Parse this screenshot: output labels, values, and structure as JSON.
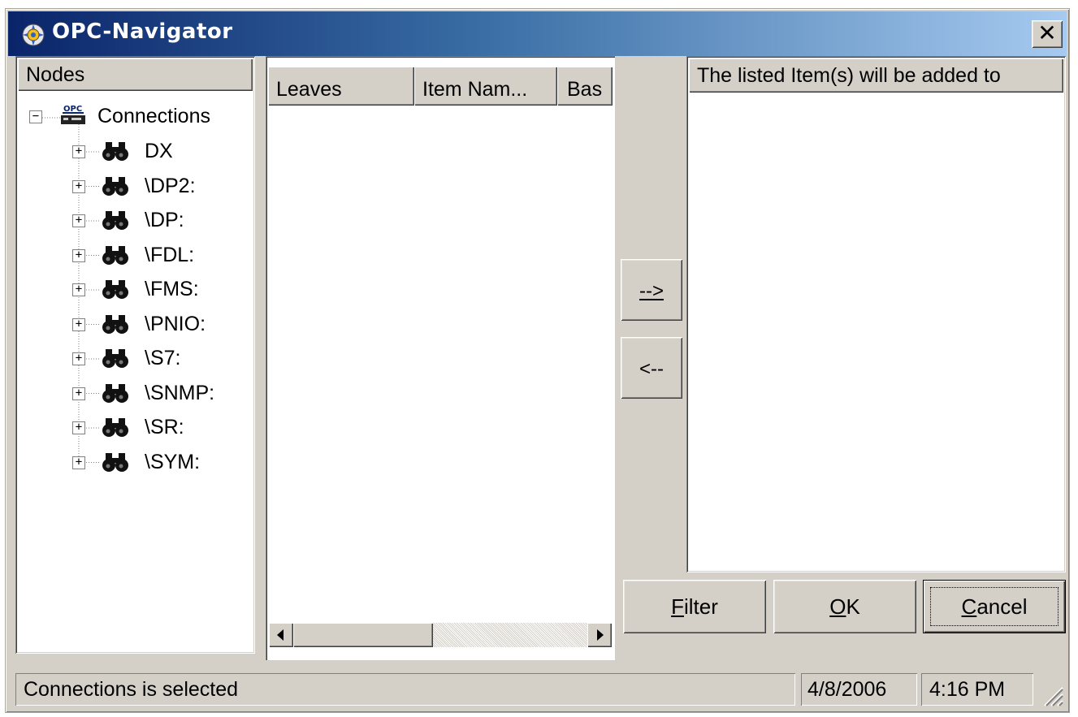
{
  "window": {
    "title": "OPC-Navigator",
    "close_glyph": "✕"
  },
  "nodes_panel": {
    "header": "Nodes",
    "root": {
      "label": "Connections",
      "icon": "opc-server-icon",
      "expander": "⊟"
    },
    "children": [
      {
        "label": "DX",
        "icon": "binoculars-icon"
      },
      {
        "label": "\\DP2:",
        "icon": "binoculars-icon"
      },
      {
        "label": "\\DP:",
        "icon": "binoculars-icon"
      },
      {
        "label": "\\FDL:",
        "icon": "binoculars-icon"
      },
      {
        "label": "\\FMS:",
        "icon": "binoculars-icon"
      },
      {
        "label": "\\PNIO:",
        "icon": "binoculars-icon"
      },
      {
        "label": "\\S7:",
        "icon": "binoculars-icon"
      },
      {
        "label": "\\SNMP:",
        "icon": "binoculars-icon"
      },
      {
        "label": "\\SR:",
        "icon": "binoculars-icon"
      },
      {
        "label": "\\SYM:",
        "icon": "binoculars-icon"
      }
    ]
  },
  "leaves_panel": {
    "columns": [
      "Leaves",
      "Item Nam...",
      "Bas"
    ]
  },
  "transfer": {
    "add_label": "-->",
    "remove_label": "<--"
  },
  "target_panel": {
    "header": "The listed Item(s) will be added to"
  },
  "buttons": {
    "filter": {
      "underline": "F",
      "rest": "ilter"
    },
    "ok": {
      "underline": "O",
      "rest": "K"
    },
    "cancel": {
      "underline": "C",
      "rest": "ancel"
    }
  },
  "statusbar": {
    "message": "Connections is selected",
    "date": "4/8/2006",
    "time": "4:16 PM"
  },
  "colors": {
    "title_gradient_start": "#0a246a",
    "title_gradient_end": "#a6caf0",
    "face": "#d4d0c8"
  }
}
